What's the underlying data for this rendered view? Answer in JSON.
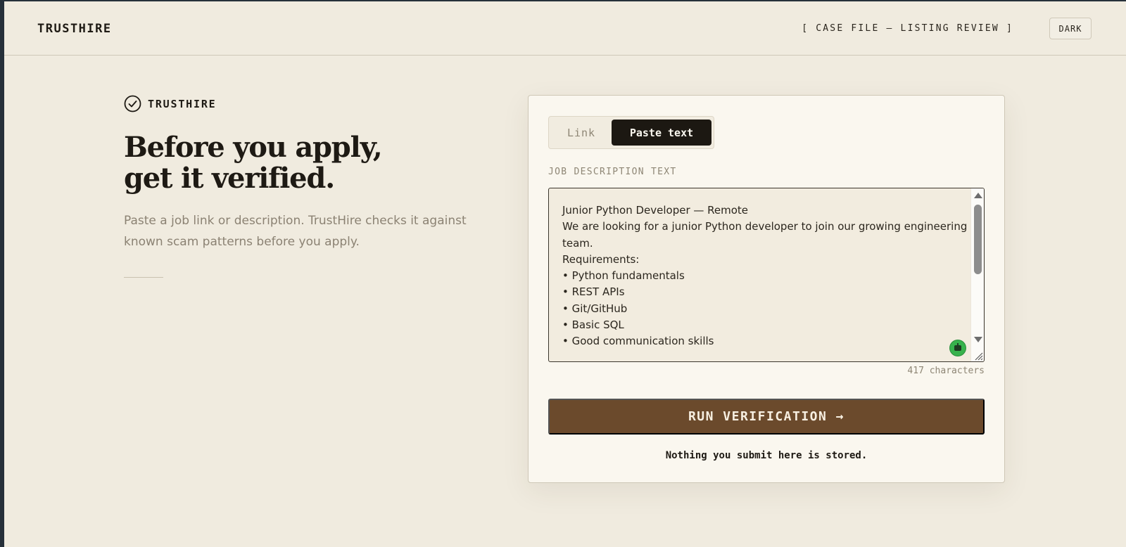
{
  "header": {
    "brand": "TRUSTHIRE",
    "case_label": "[ CASE FILE — LISTING REVIEW ]",
    "theme_toggle_label": "DARK"
  },
  "hero": {
    "brand_label": "TRUSTHIRE",
    "headline_line1": "Before you apply,",
    "headline_line2": "get it verified.",
    "subtext": "Paste a job link or description. TrustHire checks it against known scam patterns before you apply."
  },
  "form": {
    "tabs": [
      {
        "label": "Link",
        "active": false
      },
      {
        "label": "Paste text",
        "active": true
      }
    ],
    "field_label": "JOB DESCRIPTION TEXT",
    "text_lines": [
      "Junior Python Developer — Remote",
      "We are looking for a junior Python developer to join our growing engineering",
      "team.",
      "Requirements:",
      "• Python fundamentals",
      "• REST APIs",
      "• Git/GitHub",
      "• Basic SQL",
      "• Good communication skills"
    ],
    "char_count": "417 characters",
    "submit_label": "RUN VERIFICATION →",
    "privacy_notice": "Nothing you submit here is stored."
  },
  "colors": {
    "page_bg": "#f0ebdf",
    "card_bg": "#faf7ef",
    "accent_button": "#6b4a2c",
    "active_tab": "#1c1812",
    "muted_text": "#8b8273"
  },
  "icons": {
    "brand_mark": "check-circle-icon",
    "extension_badge": "bot-icon"
  }
}
